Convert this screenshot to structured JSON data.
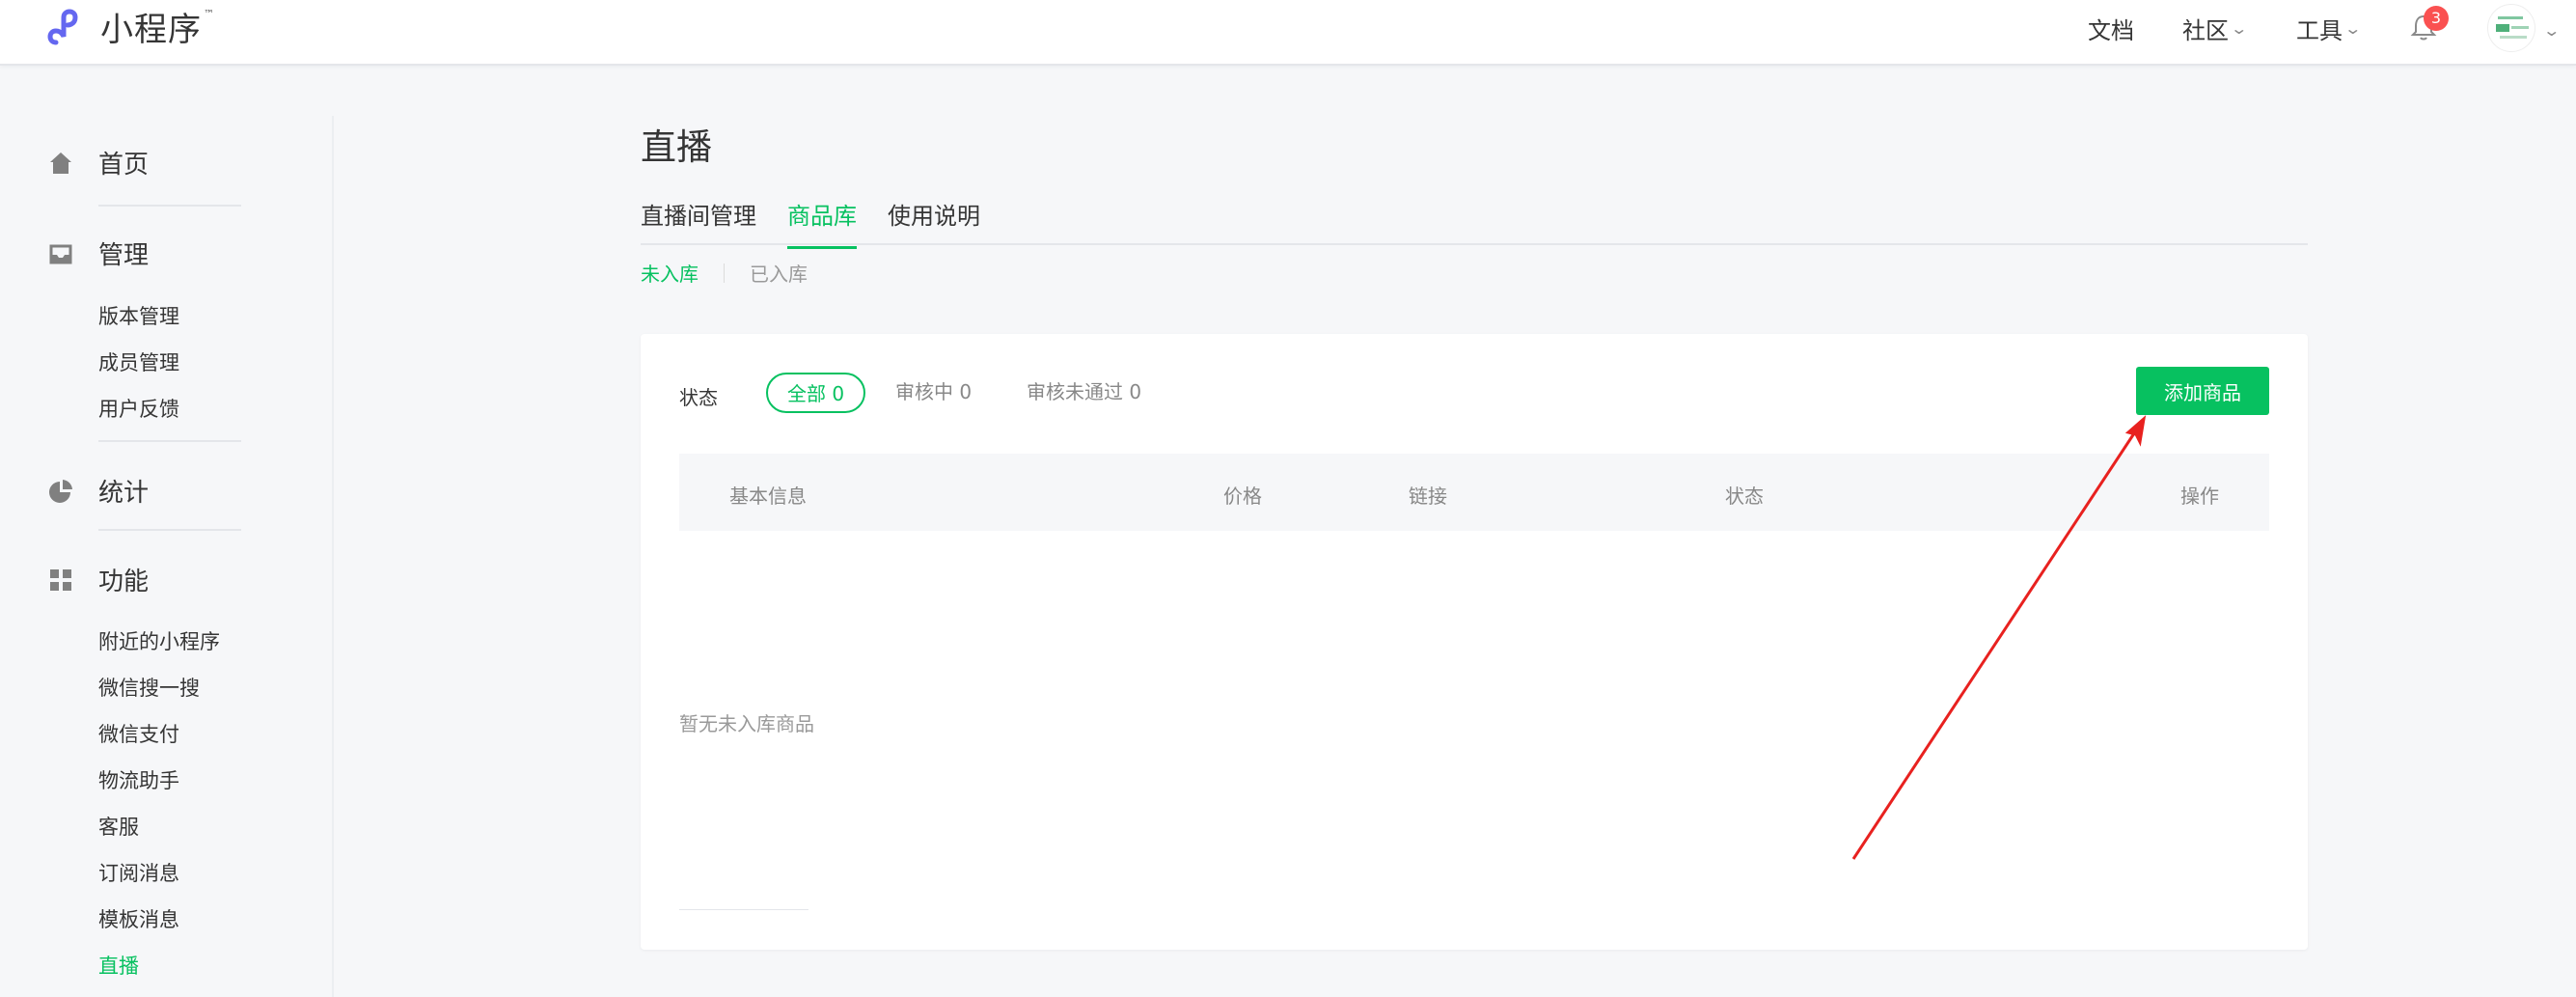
{
  "header": {
    "logo_text": "小程序",
    "logo_tm": "™",
    "nav": {
      "docs": "文档",
      "community": "社区",
      "tools": "工具"
    },
    "notification_count": "3"
  },
  "sidebar": {
    "home": "首页",
    "manage": "管理",
    "manage_items": [
      "版本管理",
      "成员管理",
      "用户反馈"
    ],
    "stats": "统计",
    "features": "功能",
    "feature_items": [
      "附近的小程序",
      "微信搜一搜",
      "微信支付",
      "物流助手",
      "客服",
      "订阅消息",
      "模板消息",
      "直播"
    ]
  },
  "main": {
    "title": "直播",
    "tabs": [
      "直播间管理",
      "商品库",
      "使用说明"
    ],
    "subtabs": [
      "未入库",
      "已入库"
    ],
    "filter": {
      "label": "状态",
      "options": [
        "全部 0",
        "审核中 0",
        "审核未通过 0"
      ]
    },
    "add_button": "添加商品",
    "table_headers": [
      "基本信息",
      "价格",
      "链接",
      "状态",
      "操作"
    ],
    "empty_text": "暂无未入库商品"
  },
  "colors": {
    "accent": "#07c160",
    "badge": "#fa5151",
    "annotation_arrow": "#e8211f"
  }
}
